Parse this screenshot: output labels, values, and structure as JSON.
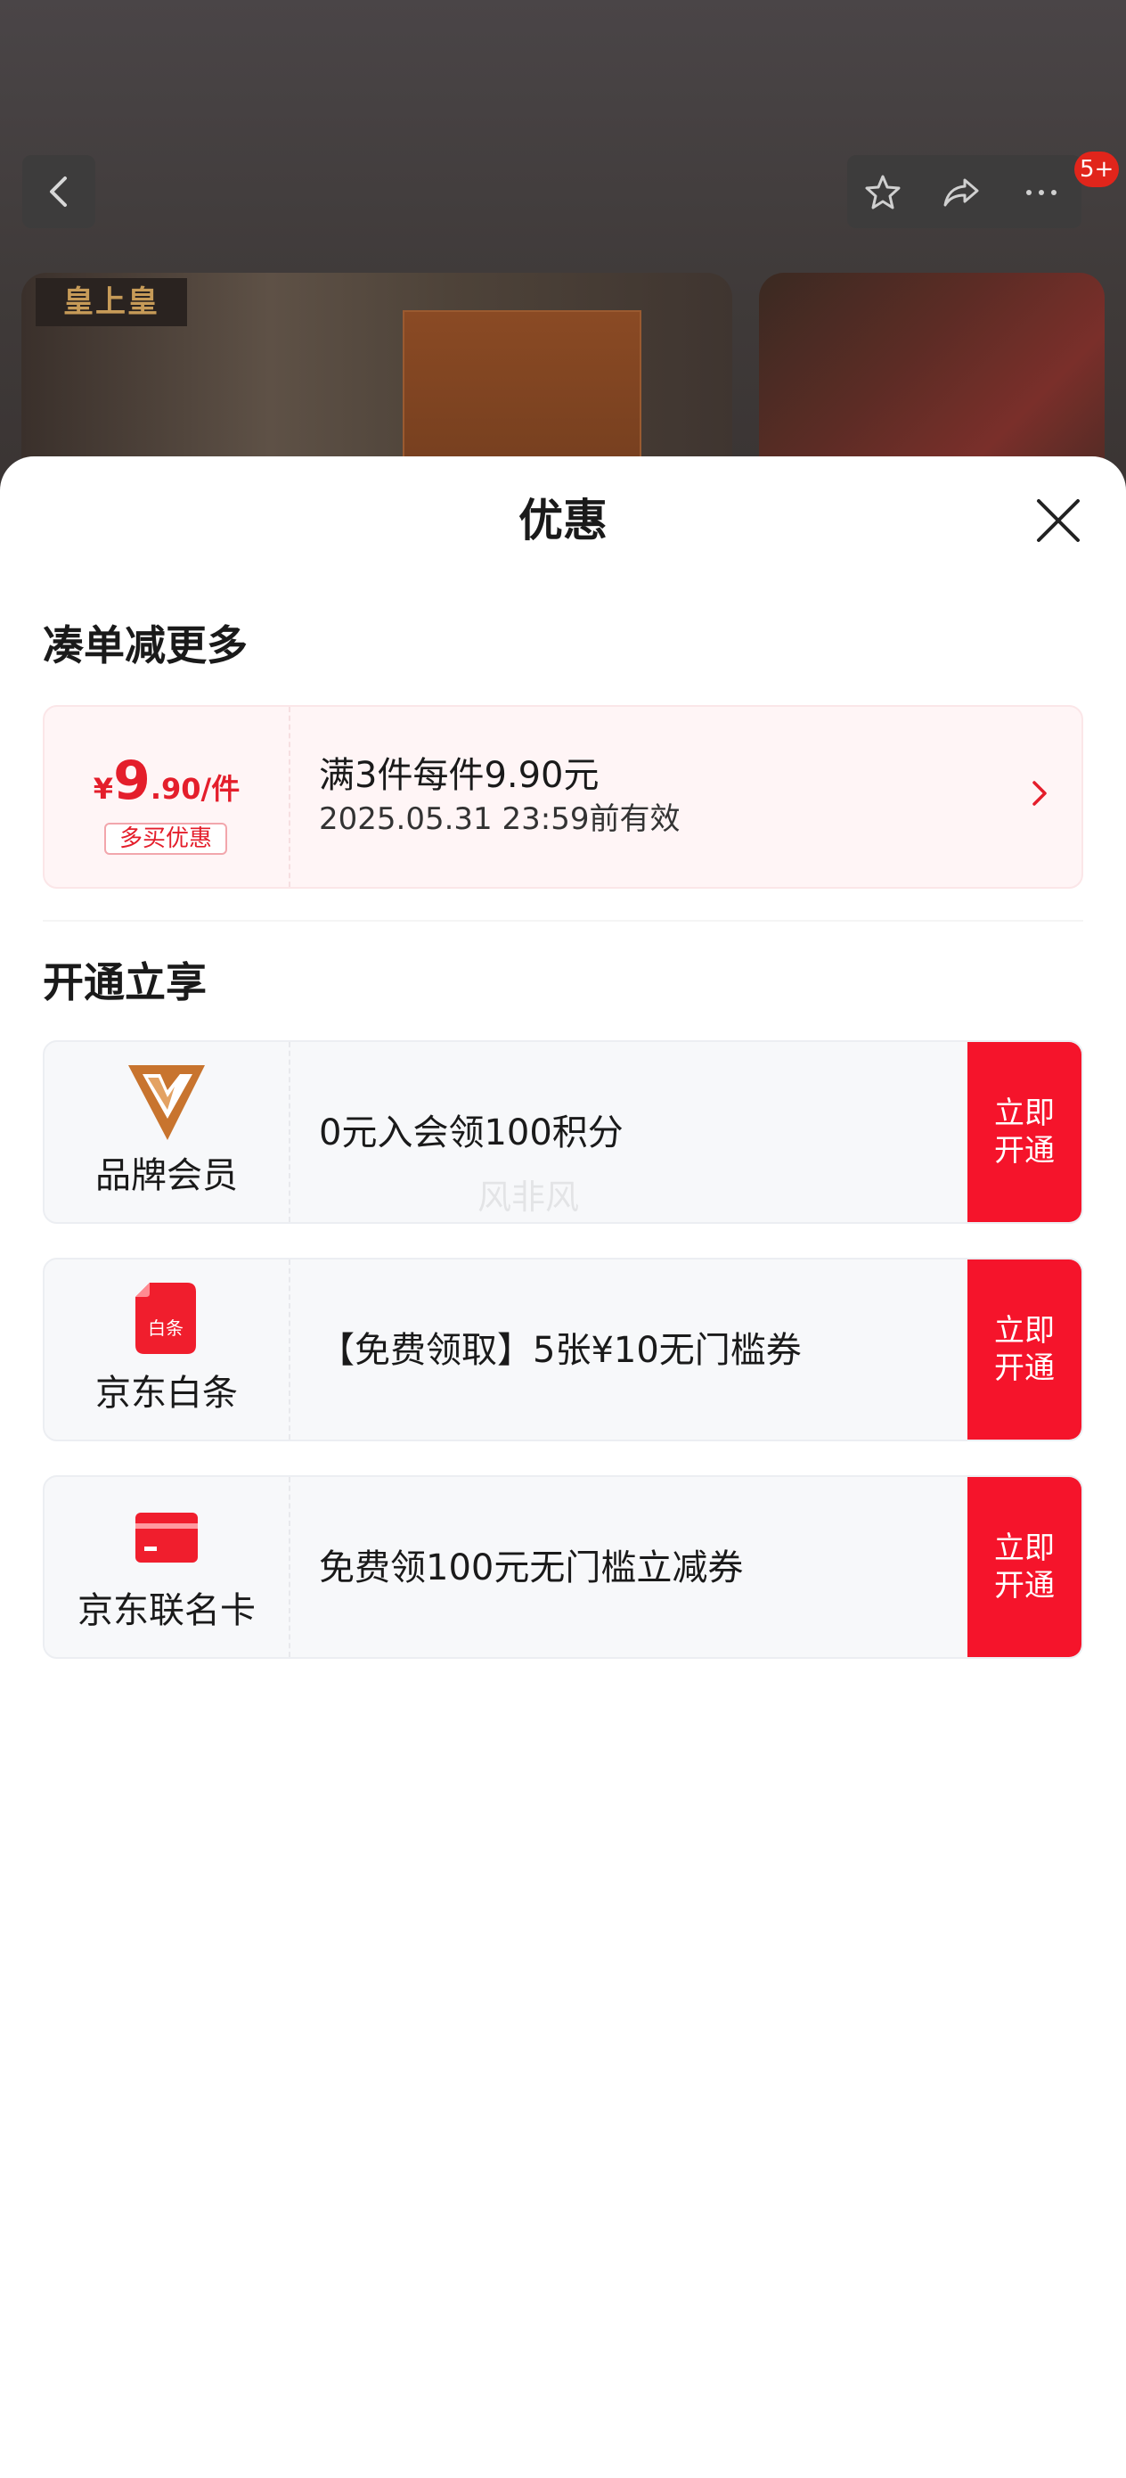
{
  "header": {
    "badge_count": "5+",
    "brand_logo_text": "皇上皇"
  },
  "sheet": {
    "title": "优惠",
    "section_bundle": {
      "title": "凑单减更多",
      "promo": {
        "currency": "¥",
        "price_integer": "9",
        "price_suffix": ".90/件",
        "tag": "多买优惠",
        "description": "满3件每件9.90元",
        "validity": "2025.05.31 23:59前有效"
      }
    },
    "section_membership": {
      "title": "开通立享",
      "cards": [
        {
          "label": "品牌会员",
          "offer": "0元入会领100积分",
          "button": "立即开通",
          "icon": "brand-v-logo"
        },
        {
          "label": "京东白条",
          "offer": "【免费领取】5张¥10无门槛券",
          "button": "立即开通",
          "icon": "baitiao-icon",
          "icon_text": "白条"
        },
        {
          "label": "京东联名卡",
          "offer": "免费领100元无门槛立减券",
          "button": "立即开通",
          "icon": "credit-card-icon"
        }
      ]
    },
    "watermark": "风非风"
  },
  "colors": {
    "accent_red": "#f5142b",
    "price_red": "#e41e2b",
    "brand_orange": "#c8742e"
  }
}
